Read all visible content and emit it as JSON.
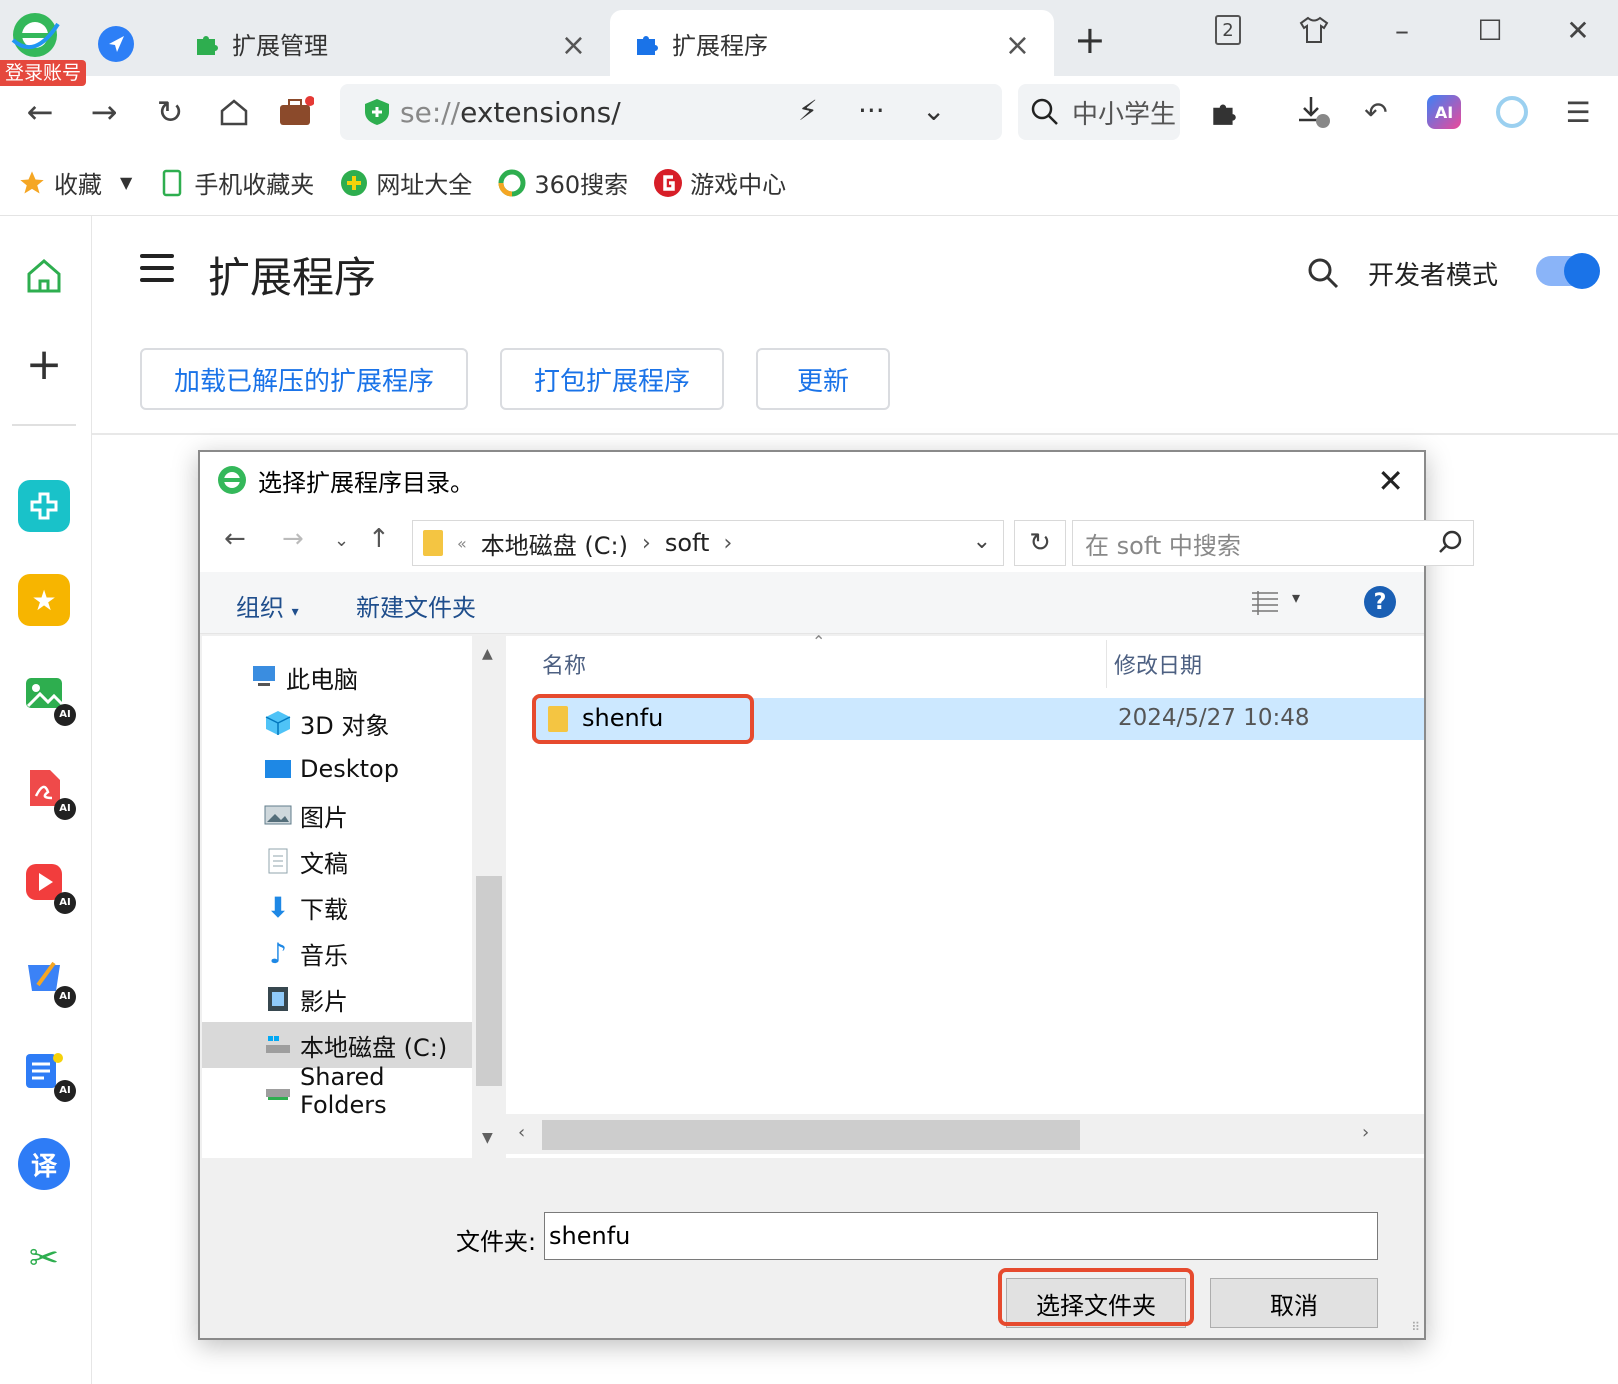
{
  "browser": {
    "login_badge": "登录账号",
    "tabs": [
      {
        "label": "扩展管理",
        "active": false
      },
      {
        "label": "扩展程序",
        "active": true
      }
    ],
    "tab_count": "2",
    "address": {
      "scheme": "se://",
      "path": "extensions/"
    },
    "search_placeholder": "中小学生",
    "bookmarks": [
      {
        "label": "收藏",
        "icon": "star-icon"
      },
      {
        "label": "手机收藏夹",
        "icon": "phone-icon"
      },
      {
        "label": "网址大全",
        "icon": "plus-circle-icon"
      },
      {
        "label": "360搜索",
        "icon": "360-search-icon"
      },
      {
        "label": "游戏中心",
        "icon": "game-center-icon"
      }
    ],
    "ai_label": "AI",
    "colors": {
      "accent": "#1a73e8",
      "highlight": "#e64a2e",
      "selection": "#cce8ff"
    }
  },
  "siderail": {
    "ai_badge": "AI",
    "translate_glyph": "译",
    "items": [
      "home-icon",
      "add-icon",
      "add-rail-icon",
      "favorites-icon",
      "ai-image-icon",
      "ai-pdf-icon",
      "ai-video-icon",
      "ai-write-icon",
      "ai-notes-icon",
      "translate-icon",
      "screenshot-icon"
    ]
  },
  "extensions_page": {
    "title": "扩展程序",
    "dev_mode_label": "开发者模式",
    "dev_mode_on": true,
    "buttons": {
      "load_unpacked": "加载已解压的扩展程序",
      "pack": "打包扩展程序",
      "update": "更新"
    }
  },
  "dialog": {
    "title": "选择扩展程序目录。",
    "breadcrumb": {
      "prefix": "«",
      "drive": "本地磁盘 (C:)",
      "folder": "soft"
    },
    "search_placeholder": "在 soft 中搜索",
    "toolbar": {
      "organize": "组织",
      "new_folder": "新建文件夹",
      "help": "?"
    },
    "tree": [
      {
        "label": "此电脑",
        "icon": "this-pc-icon",
        "indent": 0
      },
      {
        "label": "3D 对象",
        "icon": "3d-objects-icon",
        "indent": 1
      },
      {
        "label": "Desktop",
        "icon": "desktop-icon",
        "indent": 1
      },
      {
        "label": "图片",
        "icon": "pictures-icon",
        "indent": 1
      },
      {
        "label": "文稿",
        "icon": "documents-icon",
        "indent": 1
      },
      {
        "label": "下载",
        "icon": "downloads-icon",
        "indent": 1
      },
      {
        "label": "音乐",
        "icon": "music-icon",
        "indent": 1
      },
      {
        "label": "影片",
        "icon": "videos-icon",
        "indent": 1
      },
      {
        "label": "本地磁盘 (C:)",
        "icon": "local-disk-icon",
        "indent": 1,
        "selected": true
      },
      {
        "label": "Shared Folders",
        "icon": "network-drive-icon",
        "indent": 1
      }
    ],
    "columns": {
      "name": "名称",
      "modified": "修改日期"
    },
    "files": [
      {
        "name": "shenfu",
        "modified": "2024/5/27 10:48",
        "selected": true
      }
    ],
    "folder_label": "文件夹:",
    "folder_value": "shenfu",
    "select_button": "选择文件夹",
    "cancel_button": "取消"
  }
}
